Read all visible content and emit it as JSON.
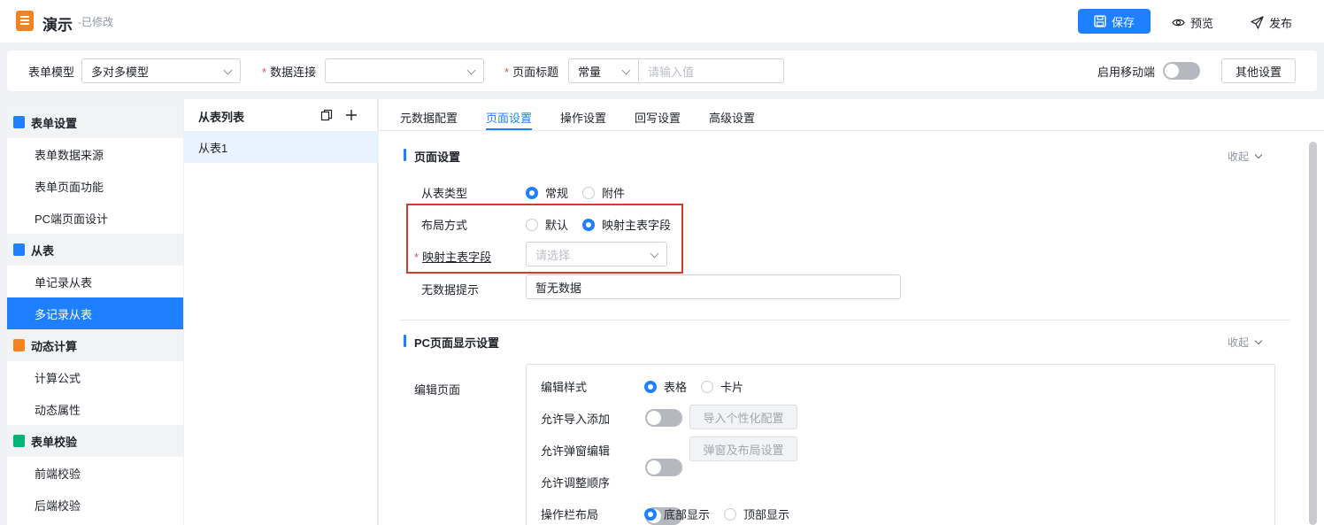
{
  "app": {
    "title": "演示",
    "status": "-已修改"
  },
  "toolbar": {
    "save": "保存",
    "preview": "预览",
    "publish": "发布"
  },
  "settings_bar": {
    "form_model_label": "表单模型",
    "form_model_value": "多对多模型",
    "data_conn_label": "数据连接",
    "data_conn_value": "",
    "page_title_label": "页面标题",
    "page_title_type": "常量",
    "page_title_placeholder": "请输入值",
    "mobile_label": "启用移动端",
    "other_settings": "其他设置"
  },
  "sidebar": {
    "groups": [
      {
        "label": "表单设置",
        "icon": "form-settings-icon",
        "items": [
          "表单数据来源",
          "表单页面功能",
          "PC端页面设计"
        ]
      },
      {
        "label": "从表",
        "icon": "sub-table-icon",
        "items": [
          "单记录从表",
          "多记录从表"
        ]
      },
      {
        "label": "动态计算",
        "icon": "grid-calc-icon",
        "items": [
          "计算公式",
          "动态属性"
        ]
      },
      {
        "label": "表单校验",
        "icon": "check-list-icon",
        "items": [
          "前端校验",
          "后端校验"
        ]
      }
    ],
    "active_item": "多记录从表"
  },
  "sub_list": {
    "title": "从表列表",
    "items": [
      "从表1"
    ]
  },
  "tabs": [
    "元数据配置",
    "页面设置",
    "操作设置",
    "回写设置",
    "高级设置"
  ],
  "active_tab": "页面设置",
  "page_settings": {
    "title": "页面设置",
    "collapse": "收起",
    "sub_type_label": "从表类型",
    "sub_type_options": [
      "常规",
      "附件"
    ],
    "sub_type_selected": "常规",
    "layout_label": "布局方式",
    "layout_options": [
      "默认",
      "映射主表字段"
    ],
    "layout_selected": "映射主表字段",
    "map_field_label": "映射主表字段",
    "map_field_placeholder": "请选择",
    "no_data_label": "无数据提示",
    "no_data_value": "暂无数据"
  },
  "pc_settings": {
    "title": "PC页面显示设置",
    "collapse": "收起",
    "edit_page_label": "编辑页面",
    "edit_style_label": "编辑样式",
    "edit_style_options": [
      "表格",
      "卡片"
    ],
    "edit_style_selected": "表格",
    "allow_import_label": "允许导入添加",
    "import_btn": "导入个性化配置",
    "allow_popup_label": "允许弹窗编辑",
    "popup_btn": "弹窗及布局设置",
    "allow_order_label": "允许调整顺序",
    "action_bar_label": "操作栏布局",
    "action_bar_options": [
      "底部显示",
      "顶部显示"
    ],
    "action_bar_selected": "底部显示"
  },
  "colors": {
    "primary": "#1e80ff",
    "highlight": "#d23c2b",
    "required": "#e34d59"
  }
}
